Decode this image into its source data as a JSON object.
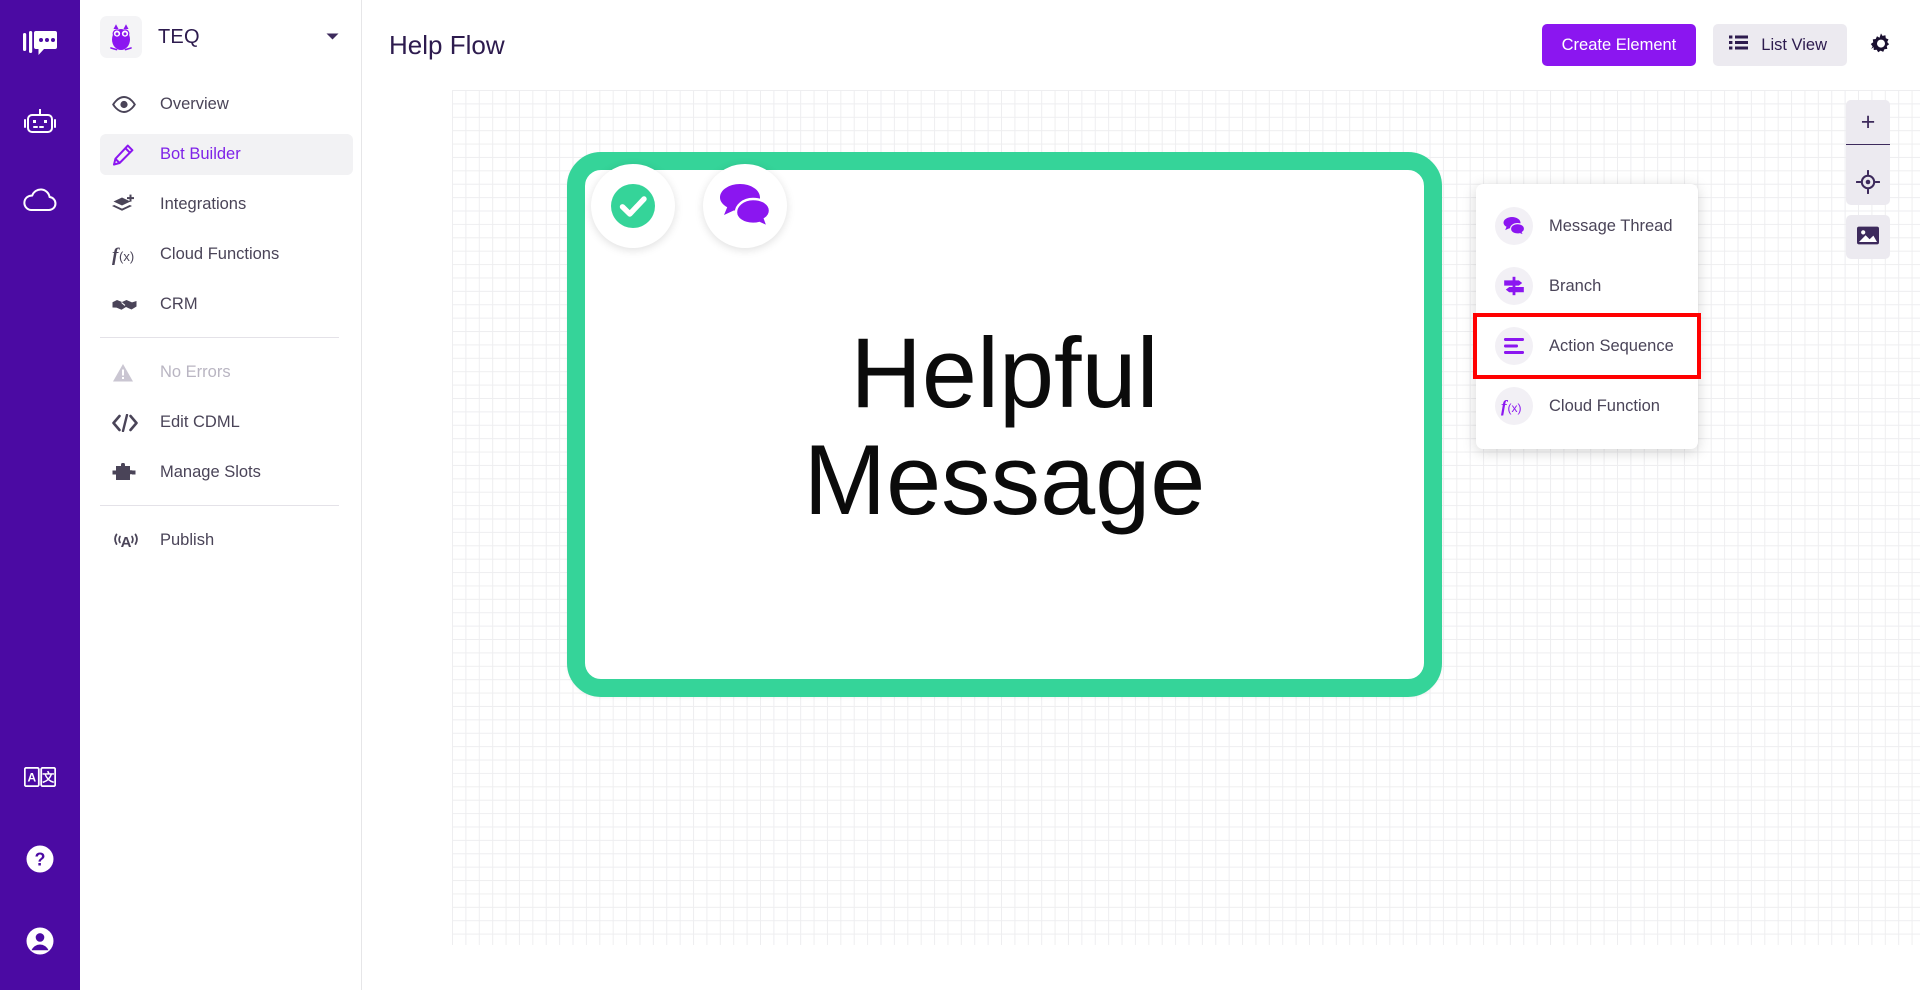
{
  "colors": {
    "rail_bg": "#4B0AA3",
    "accent_purple": "#8B16F0",
    "active_purple": "#7E22E8",
    "node_green": "#35D499",
    "highlight_red": "#FF0000",
    "title_ink": "#2d1b4e",
    "nav_ink": "#4a4458",
    "muted_ink": "#b9b5c2",
    "grid_line": "#eeeef0"
  },
  "rail": {
    "top_items": [
      {
        "name": "messages-icon",
        "label": "Messages"
      },
      {
        "name": "bot-icon",
        "label": "Bots"
      },
      {
        "name": "cloud-icon",
        "label": "Cloud"
      }
    ],
    "bottom_items": [
      {
        "name": "translate-icon",
        "label": "Translate"
      },
      {
        "name": "help-icon",
        "label": "Help"
      },
      {
        "name": "account-icon",
        "label": "Account"
      }
    ]
  },
  "sidebar": {
    "brand": {
      "name": "TEQ",
      "logo_icon": "owl-logo-icon",
      "caret_icon": "chevron-down-icon"
    },
    "items": [
      {
        "label": "Overview",
        "icon": "eye-icon",
        "state": "default"
      },
      {
        "label": "Bot Builder",
        "icon": "pencil-icon",
        "state": "active"
      },
      {
        "label": "Integrations",
        "icon": "layers-plus-icon",
        "state": "default"
      },
      {
        "label": "Cloud Functions",
        "icon": "function-icon",
        "state": "default"
      },
      {
        "label": "CRM",
        "icon": "handshake-icon",
        "state": "default"
      }
    ],
    "items_group2": [
      {
        "label": "No Errors",
        "icon": "warning-icon",
        "state": "muted"
      },
      {
        "label": "Edit CDML",
        "icon": "code-icon",
        "state": "default"
      },
      {
        "label": "Manage Slots",
        "icon": "puzzle-icon",
        "state": "default"
      }
    ],
    "items_group3": [
      {
        "label": "Publish",
        "icon": "broadcast-icon",
        "state": "default"
      }
    ]
  },
  "topbar": {
    "title": "Help Flow",
    "create_element_label": "Create Element",
    "list_view_label": "List View",
    "list_view_icon": "list-icon",
    "settings_icon": "gear-icon"
  },
  "dropdown": {
    "items": [
      {
        "label": "Message Thread",
        "icon": "chat-bubbles-icon",
        "highlighted": false
      },
      {
        "label": "Branch",
        "icon": "signpost-icon",
        "highlighted": false
      },
      {
        "label": "Action Sequence",
        "icon": "list-lines-icon",
        "highlighted": true
      },
      {
        "label": "Cloud Function",
        "icon": "function-icon",
        "highlighted": false
      }
    ]
  },
  "canvas": {
    "node": {
      "text_line1": "Helpful",
      "text_line2": "Message",
      "status_icon": "check-circle-icon",
      "type_icon": "chat-bubbles-icon"
    },
    "tools": {
      "zoom_in": "+",
      "zoom_out": "−",
      "recenter_icon": "crosshair-icon",
      "snapshot_icon": "image-icon"
    }
  }
}
